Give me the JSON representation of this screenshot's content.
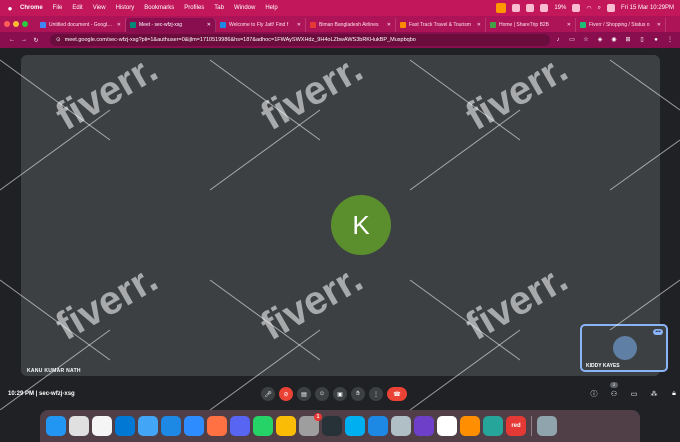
{
  "menubar": {
    "app": "Chrome",
    "items": [
      "File",
      "Edit",
      "View",
      "History",
      "Bookmarks",
      "Profiles",
      "Tab",
      "Window",
      "Help"
    ],
    "battery": "19%",
    "clock": "Fri 15 Mar 10:29PM"
  },
  "tabs": [
    {
      "label": "Untitled document - Google Docs",
      "favicon_color": "#4285f4"
    },
    {
      "label": "Meet - sec-wfzj-xsg",
      "favicon_color": "#00897b",
      "active": true
    },
    {
      "label": "Welcome to Fly Jatt! Find f",
      "favicon_color": "#1e88e5"
    },
    {
      "label": "Biman Bangladesh Airlines",
      "favicon_color": "#e53935"
    },
    {
      "label": "Fast Track Travel & Tourism",
      "favicon_color": "#fb8c00"
    },
    {
      "label": "Home | ShareTrip B2B",
      "favicon_color": "#43a047"
    },
    {
      "label": "Fiverr / Shopping / Status o",
      "favicon_color": "#1dbf73"
    }
  ],
  "address_bar": {
    "url": "meet.google.com/sec-wfzj-xsg?pli=1&authuser=0&ijlm=1710519986&hs=187&adhoc=1FWAySWXHdz_9H4oLZbwAWS3bRKHukBP_Muspbqbo"
  },
  "meeting": {
    "avatar_letter": "K",
    "avatar_color": "#5b8f2e",
    "presenter_name": "KANU KUMAR NATH",
    "self_name": "KIDDY KAYES",
    "time": "10:29 PM",
    "code": "sec-wfzj-xsg",
    "participants_count": "2",
    "watermark": "fiverr."
  },
  "dock": {
    "icons": [
      {
        "name": "finder-icon",
        "color": "#2196f3"
      },
      {
        "name": "launchpad-icon",
        "color": "#e0e0e0"
      },
      {
        "name": "photos-icon",
        "color": "#f5f5f5"
      },
      {
        "name": "vscode-icon",
        "color": "#0078d4"
      },
      {
        "name": "mail-icon",
        "color": "#42a5f5"
      },
      {
        "name": "safari-icon",
        "color": "#1e88e5"
      },
      {
        "name": "zoom-icon",
        "color": "#2d8cff"
      },
      {
        "name": "vector-pen-icon",
        "color": "#ff7043"
      },
      {
        "name": "discord-icon",
        "color": "#5865f2"
      },
      {
        "name": "whatsapp-icon",
        "color": "#25d366"
      },
      {
        "name": "chrome-icon",
        "color": "#fbbc05"
      },
      {
        "name": "system-settings-icon",
        "color": "#9e9e9e",
        "badge": "1"
      },
      {
        "name": "terminal-icon",
        "color": "#263238"
      },
      {
        "name": "skype-icon",
        "color": "#00aff0"
      },
      {
        "name": "app-store-icon",
        "color": "#1e88e5"
      },
      {
        "name": "utility-icon",
        "color": "#b0bec5"
      },
      {
        "name": "github-icon",
        "color": "#6e40c9"
      },
      {
        "name": "slack-icon",
        "color": "#ffffff"
      },
      {
        "name": "vlc-icon",
        "color": "#ff8f00"
      },
      {
        "name": "globe-app-icon",
        "color": "#26a69a"
      },
      {
        "name": "red-app-icon",
        "color": "#e53935",
        "text": "red"
      },
      {
        "name": "trash-icon",
        "color": "#90a4ae"
      }
    ]
  }
}
